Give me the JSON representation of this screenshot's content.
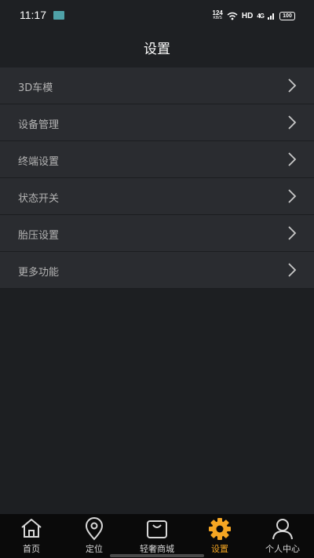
{
  "status_bar": {
    "time": "11:17",
    "net_speed_value": "124",
    "net_speed_unit": "KB/S",
    "hd": "HD",
    "signal": "4G",
    "battery": "100"
  },
  "header": {
    "title": "设置"
  },
  "menu": {
    "items": [
      {
        "label": "3D车模"
      },
      {
        "label": "设备管理"
      },
      {
        "label": "终端设置"
      },
      {
        "label": "状态开关"
      },
      {
        "label": "胎压设置"
      },
      {
        "label": "更多功能"
      }
    ]
  },
  "tabbar": {
    "tabs": [
      {
        "label": "首页",
        "icon": "home-icon"
      },
      {
        "label": "定位",
        "icon": "location-pin-icon"
      },
      {
        "label": "轻奢商城",
        "icon": "shopping-bag-icon"
      },
      {
        "label": "设置",
        "icon": "gear-icon"
      },
      {
        "label": "个人中心",
        "icon": "person-icon"
      }
    ],
    "active_index": 3
  },
  "colors": {
    "background": "#1d1f22",
    "header": "#1e2023",
    "menu_item": "#2a2c30",
    "tabbar": "#0a0a0a",
    "accent": "#f5a623"
  }
}
